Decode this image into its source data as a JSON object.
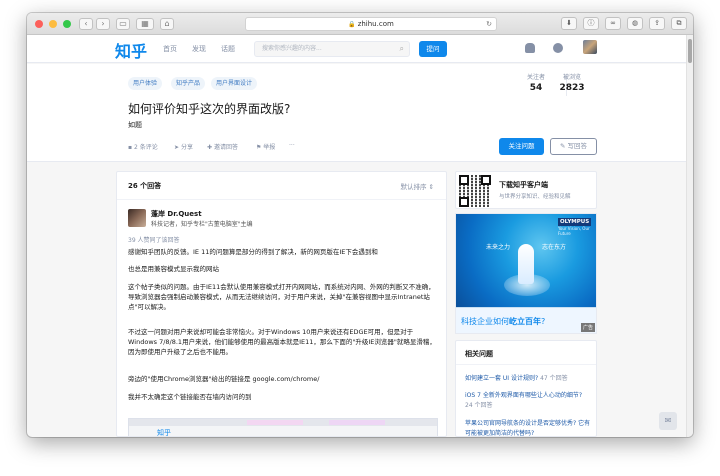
{
  "browser": {
    "url": "zhihu.com",
    "colors": {
      "close": "#fc605b",
      "minimize": "#fdbc40",
      "zoom": "#34c84a"
    }
  },
  "header": {
    "logo": "知乎",
    "nav": [
      "首页",
      "发现",
      "话题"
    ],
    "search_placeholder": "搜索你感兴趣的内容...",
    "ask_label": "提问"
  },
  "question": {
    "tags": [
      "用户体验",
      "知乎产品",
      "用户界面设计"
    ],
    "title": "如何评价知乎这次的界面改版?",
    "description": "如题",
    "actions": {
      "comments": "2 条评论",
      "share": "分享",
      "invite": "邀请回答",
      "report": "举报",
      "more": "···"
    },
    "followers_label": "关注者",
    "followers": "54",
    "views_label": "被浏览",
    "views": "2823",
    "follow_label": "关注问题",
    "write_label": "写回答"
  },
  "answers": {
    "count_label": "26 个回答",
    "sort_label": "默认排序",
    "author_name": "蓬岸 Dr.Quest",
    "author_bio": "科技记者，知乎专栏\"古董电脑室\"主编",
    "votes": "39 人赞同了该回答",
    "paragraphs": [
      "感谢知乎团队的反馈。IE 11的问题算是部分的得到了解决，新的网页版在IE下会遇到和",
      "也总是用兼容模式显示我的网站",
      "这个帖子类似的问题。由于IE11会默认使用兼容模式打开内网网站，而系统对内网、外网的判断又不准确，导致浏览器会强制启动兼容模式，从而无法继续访问，对于用户来说，关掉\"在兼容视图中显示Intranet站点\"可以解决。",
      "不过这一问题对用户来说却可能会非常恼火。对于Windows 10用户来说还有EDGE可用，但是对于Windows 7/8/8.1用户来说，他们能够使用的最高版本就是IE11，那么下面的\"升级IE浏览器\"就略显滑稽，因为即使用户升级了之后也不能用。",
      "旁边的\"使用Chrome浏览器\"给出的链接是 google.com/chrome/",
      "我并不太确定这个链接能否在墙内访问的到"
    ],
    "preview_logo": "知乎"
  },
  "sidebar": {
    "app_title": "下载知乎客户端",
    "app_subtitle": "与世界分享知识、经验和见解",
    "ad": {
      "brand": "OLYMPUS",
      "brand_tagline": "Your Vision, Our Future",
      "left_text": "未来之力",
      "right_text": "志在东方",
      "footer_text_prefix": "科技企业如何",
      "footer_text_bold": "屹立百年",
      "footer_text_suffix": "?",
      "tag": "广告"
    },
    "related_title": "相关问题",
    "related": [
      {
        "text": "如何建立一套 UI 设计规则?",
        "meta": "47 个回答"
      },
      {
        "text": "iOS 7 全新外观界面有哪些让人心动的细节?",
        "meta": "24 个回答"
      },
      {
        "text": "苹果公司官网导航条的设计是否定够优秀? 它有可能被更加简洁的代替吗?",
        "meta": ""
      }
    ]
  }
}
